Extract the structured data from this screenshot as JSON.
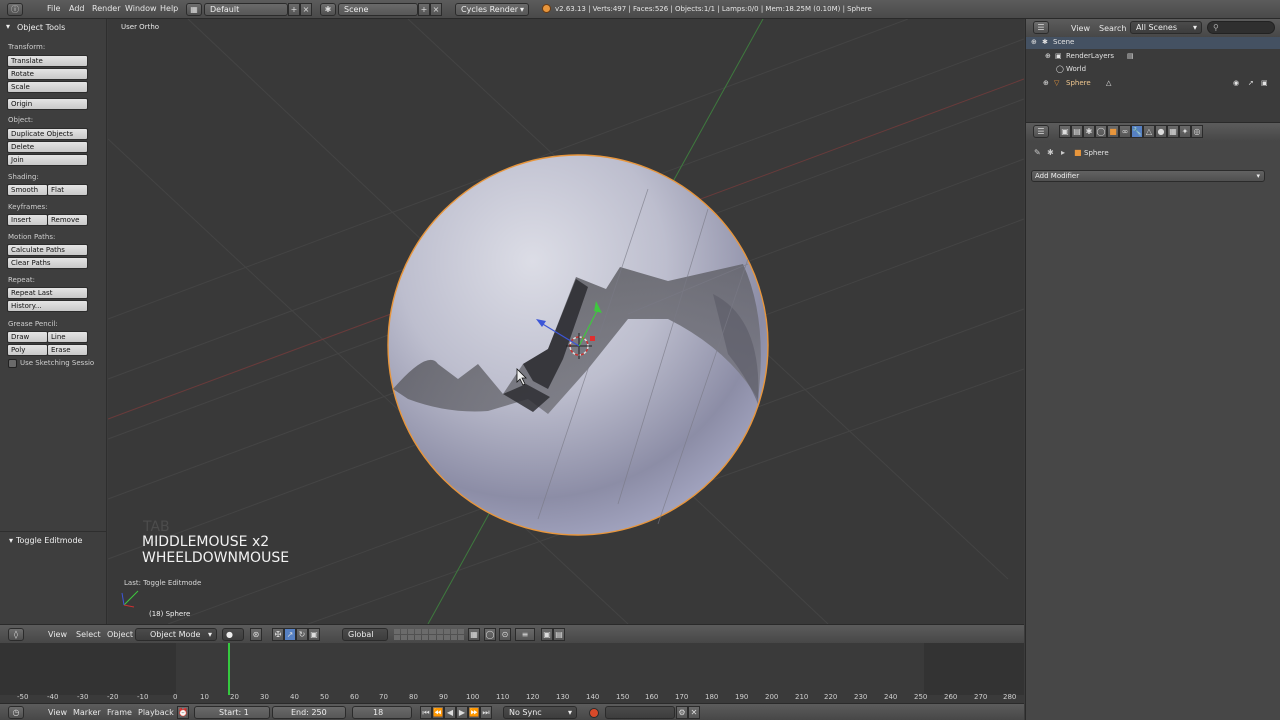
{
  "topbar": {
    "menu": [
      "File",
      "Add",
      "Render",
      "Window",
      "Help"
    ],
    "layout": "Default",
    "scene": "Scene",
    "engine": "Cycles Render",
    "stats": "v2.63.13 | Verts:497 | Faces:526 | Objects:1/1 | Lamps:0/0 | Mem:18.25M (0.10M) | Sphere"
  },
  "toolshelf": {
    "title": "Object Tools",
    "transform_label": "Transform:",
    "translate": "Translate",
    "rotate": "Rotate",
    "scale": "Scale",
    "origin": "Origin",
    "object_label": "Object:",
    "duplicate": "Duplicate Objects",
    "delete": "Delete",
    "join": "Join",
    "shading_label": "Shading:",
    "smooth": "Smooth",
    "flat": "Flat",
    "keyframes_label": "Keyframes:",
    "insert": "Insert",
    "remove": "Remove",
    "motion_label": "Motion Paths:",
    "calc_paths": "Calculate Paths",
    "clear_paths": "Clear Paths",
    "repeat_label": "Repeat:",
    "repeat_last": "Repeat Last",
    "history": "History...",
    "grease_label": "Grease Pencil:",
    "draw": "Draw",
    "line": "Line",
    "poly": "Poly",
    "erase": "Erase",
    "sketching": "Use Sketching Sessio",
    "toggle_editmode": "Toggle Editmode"
  },
  "viewport": {
    "view_name": "User Ortho",
    "key_faded": "TAB",
    "key_line1": "MIDDLEMOUSE x2",
    "key_line2": "WHEELDOWNMOUSE",
    "last_op": "Last: Toggle Editmode",
    "object_info": "(18) Sphere"
  },
  "v3dheader": {
    "view": "View",
    "select": "Select",
    "object": "Object",
    "mode": "Object Mode",
    "orientation": "Global"
  },
  "timeline": {
    "ticks": [
      "-50",
      "-40",
      "-30",
      "-20",
      "-10",
      "0",
      "10",
      "20",
      "30",
      "40",
      "50",
      "60",
      "70",
      "80",
      "90",
      "100",
      "110",
      "120",
      "130",
      "140",
      "150",
      "160",
      "170",
      "180",
      "190",
      "200",
      "210",
      "220",
      "230",
      "240",
      "250",
      "260",
      "270",
      "280"
    ],
    "current_frame": 18,
    "start": "Start: 1",
    "end": "End: 250",
    "frame": "18",
    "sync": "No Sync",
    "menus": [
      "View",
      "Marker",
      "Frame",
      "Playback"
    ]
  },
  "outliner": {
    "view": "View",
    "search": "Search",
    "filter": "All Scenes",
    "items": [
      "Scene",
      "RenderLayers",
      "World",
      "Sphere"
    ]
  },
  "properties": {
    "object_name": "Sphere",
    "add_modifier": "Add Modifier"
  },
  "colors": {
    "selection_outline": "#e8963c",
    "viewport_bg": "#393939",
    "active_tab": "#5680c2",
    "timeline_cursor": "#35c93f"
  }
}
